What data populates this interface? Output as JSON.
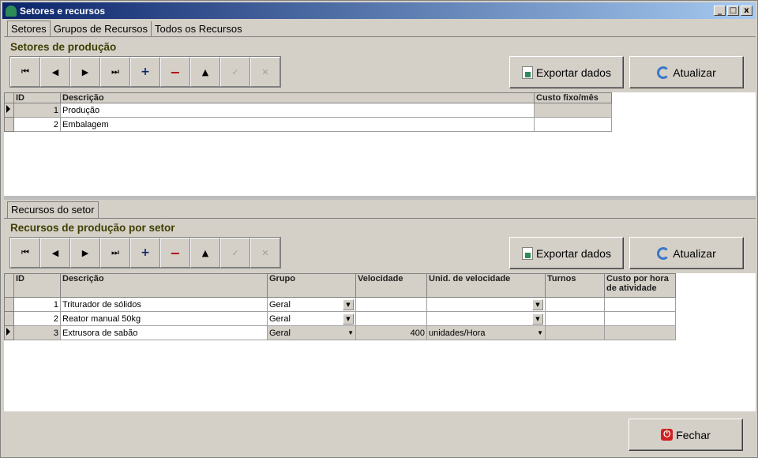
{
  "window": {
    "title": "Setores e recursos",
    "min": "_",
    "max": "□",
    "close": "x"
  },
  "top_tabs": [
    "Setores",
    "Grupos de Recursos",
    "Todos os Recursos"
  ],
  "setores": {
    "title": "Setores de produção",
    "export_label": "Exportar dados",
    "refresh_label": "Atualizar",
    "columns": [
      "ID",
      "Descrição",
      "Custo fixo/mês"
    ],
    "rows": [
      {
        "id": "1",
        "desc": "Produção",
        "custo": ""
      },
      {
        "id": "2",
        "desc": "Embalagem",
        "custo": ""
      }
    ]
  },
  "bottom_tab": "Recursos do setor",
  "recursos": {
    "title": "Recursos de produção por setor",
    "export_label": "Exportar dados",
    "refresh_label": "Atualizar",
    "columns": [
      "ID",
      "Descrição",
      "Grupo",
      "Velocidade",
      "Unid. de velocidade",
      "Turnos",
      "Custo por hora de atividade"
    ],
    "rows": [
      {
        "id": "1",
        "desc": "Triturador de sólidos",
        "grupo": "Geral",
        "vel": "",
        "unid": "",
        "turnos": "",
        "custo": ""
      },
      {
        "id": "2",
        "desc": "Reator manual 50kg",
        "grupo": "Geral",
        "vel": "",
        "unid": "",
        "turnos": "",
        "custo": ""
      },
      {
        "id": "3",
        "desc": "Extrusora de sabão",
        "grupo": "Geral",
        "vel": "400",
        "unid": "unidades/Hora",
        "turnos": "",
        "custo": ""
      }
    ]
  },
  "nav_icons": [
    "first-icon",
    "prior-icon",
    "next-icon",
    "last-icon",
    "insert-icon",
    "delete-icon",
    "edit-icon",
    "post-icon",
    "cancel-icon"
  ],
  "nav_glyphs": [
    "⏮",
    "◀",
    "▶",
    "⏭",
    "+",
    "−",
    "▲",
    "✓",
    "✕"
  ],
  "close_label": "Fechar",
  "colors": {
    "title_start": "#0a246a",
    "title_end": "#a6caf0",
    "section_title": "#3f3f00"
  }
}
